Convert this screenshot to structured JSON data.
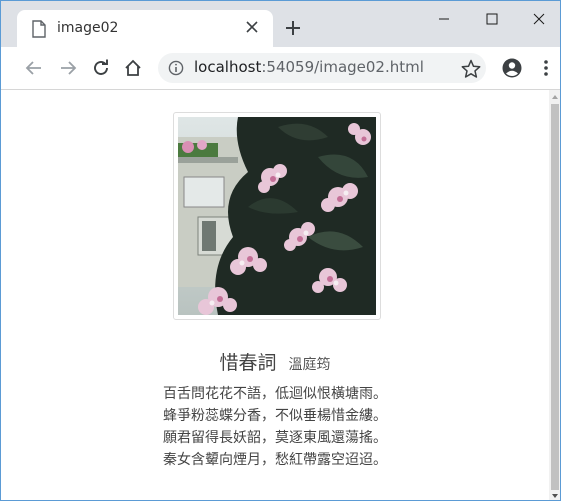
{
  "browser": {
    "tab_title": "image02",
    "url_host": "localhost",
    "url_rest": ":54059/image02.html"
  },
  "page": {
    "poem": {
      "title": "惜春詞",
      "author": "溫庭筠",
      "lines": [
        "百舌問花花不語，低迴似恨橫塘雨。",
        "蜂爭粉蕊蝶分香，不似垂楊惜金縷。",
        "願君留得長妖韶，莫逐東風還蕩搖。",
        "秦女含顰向煙月，愁紅帶露空迢迢。"
      ]
    },
    "image": {
      "subject": "pink-white flowering shrub in front of a building"
    }
  },
  "icons": {
    "tab": "page-icon",
    "tab_close": "close-icon",
    "new_tab": "plus-icon",
    "back": "back-arrow-icon",
    "forward": "forward-arrow-icon",
    "reload": "reload-icon",
    "home": "home-icon",
    "site_info": "info-icon",
    "bookmark": "star-icon",
    "account": "account-icon",
    "menu": "kebab-menu-icon"
  },
  "colors": {
    "tabstrip_bg": "#dee1e6",
    "omnibox_bg": "#f1f3f4",
    "text": "#444444"
  }
}
